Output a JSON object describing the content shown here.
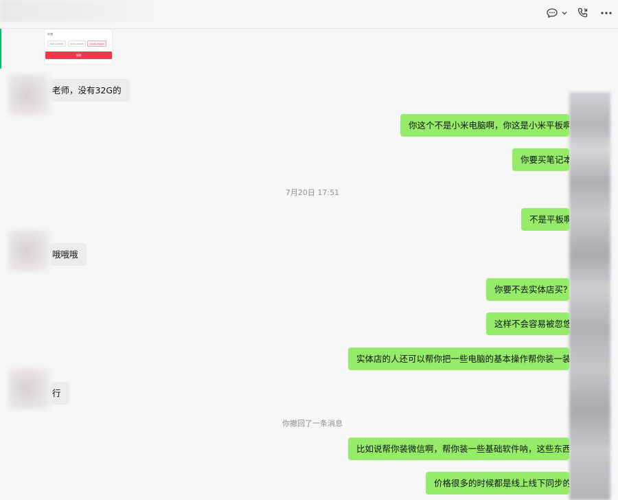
{
  "header": {
    "icons": [
      "chat-bubble-icon",
      "chevron-down-icon",
      "call-icon",
      "more-icon"
    ]
  },
  "product_card": {
    "label": "存储",
    "options": [
      "8GB+128GB",
      "8GB+256GB",
      "12GB+256GB"
    ],
    "buy_label": "领取"
  },
  "messages": [
    {
      "side": "in",
      "text": "老师，没有32G的"
    },
    {
      "side": "out",
      "text": "你这个不是小米电脑啊，你这是小米平板啊"
    },
    {
      "side": "out",
      "text": "你要买笔记本"
    },
    {
      "side": "sys",
      "text": "7月20日 17:51"
    },
    {
      "side": "out",
      "text": "不是平板啊"
    },
    {
      "side": "in",
      "text": "哦哦哦"
    },
    {
      "side": "out",
      "text": "你要不去实体店买？"
    },
    {
      "side": "out",
      "text": "这样不会容易被忽悠"
    },
    {
      "side": "out",
      "text": "实体店的人还可以帮你把一些电脑的基本操作帮你装一装"
    },
    {
      "side": "in",
      "text": "行"
    },
    {
      "side": "sys",
      "text": "你撤回了一条消息"
    },
    {
      "side": "out",
      "text": "比如说帮你装微信啊，帮你装一些基础软件呐，这些东西"
    },
    {
      "side": "out",
      "text": "价格很多的时候都是线上线下同步的"
    }
  ],
  "colors": {
    "outgoing_bubble": "#95ec69",
    "incoming_bubble": "#ececec",
    "accent": "#07c160",
    "buy_button": "#f2374d"
  }
}
